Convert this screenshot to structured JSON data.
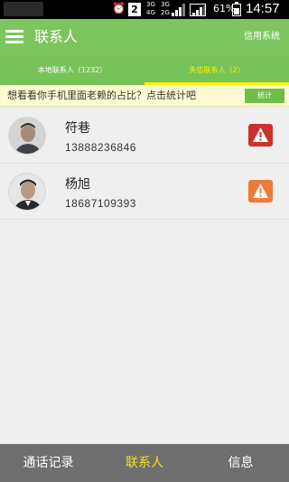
{
  "statusbar": {
    "sim_slot": "2",
    "net1_top": "3G",
    "net1_bottom": "4G",
    "net2_top": "3G",
    "net2_bottom": "2G",
    "battery_pct": "61%",
    "time": "14:57"
  },
  "header": {
    "title": "联系人",
    "credit_link": "信用系统",
    "bg_color": "#7dc55e"
  },
  "tabs": [
    {
      "label": "本地联系人（1232）",
      "active": false
    },
    {
      "label": "失信联系人（2）",
      "active": true
    }
  ],
  "banner": {
    "text": "想看看你手机里面老赖的占比？点击统计吧",
    "button_label": "统计"
  },
  "contacts": [
    {
      "name": "符巷",
      "phone": "13888236846",
      "warning_color": "#c9332c",
      "icon": "alert-icon"
    },
    {
      "name": "杨旭",
      "phone": "18687109393",
      "warning_color": "#ee7b3a",
      "icon": "alert-icon"
    }
  ],
  "bottom_nav": [
    {
      "label": "通话记录",
      "active": false
    },
    {
      "label": "联系人",
      "active": true
    },
    {
      "label": "信息",
      "active": false
    }
  ]
}
